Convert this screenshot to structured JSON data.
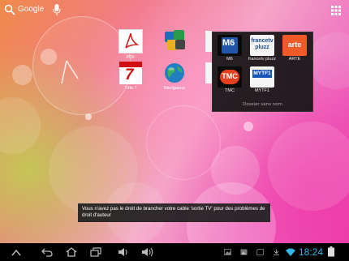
{
  "top_bar": {
    "search_label": "Google"
  },
  "home_apps": [
    {
      "label": "PDF"
    },
    {
      "label": ""
    },
    {
      "label": "Téle 7"
    },
    {
      "label": "Navigateur"
    }
  ],
  "folder": {
    "name": "Dossier sans nom",
    "channels": [
      {
        "label": "M6",
        "logo_text": "M6"
      },
      {
        "label": "francetv pluzz",
        "logo_text": "francetv pluzz"
      },
      {
        "label": "ARTE",
        "logo_text": "arte"
      },
      {
        "label": "TMC",
        "logo_text": "TMC"
      },
      {
        "label": "MYTF1",
        "logo_text": "MYTF1"
      }
    ]
  },
  "toast": {
    "message": "Vous n'avez pas le droit de brancher votre cable 'sortie TV' pour des problèmes de droit d'auteur"
  },
  "status": {
    "time": "18:24"
  },
  "colors": {
    "clock": "#33b5e5",
    "arte": "#f05a28",
    "tmc": "#e5401e"
  }
}
